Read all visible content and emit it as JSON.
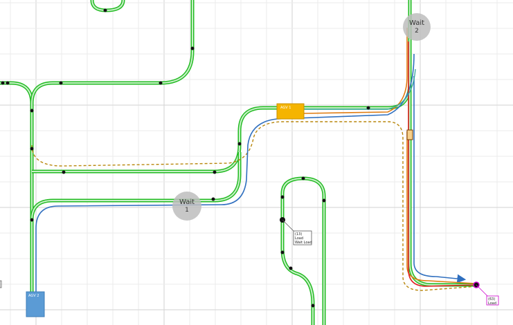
{
  "colors": {
    "background": "#ffffff",
    "grid_minor": "#ebebeb",
    "grid_major": "#d2d2d2",
    "track_outer": "#22bb22",
    "track_inner": "#c8f0c8",
    "route_blue": "#2f6fbf",
    "route_orange": "#e07b10",
    "route_dashed": "#b8860b",
    "route_red": "#e02020",
    "route_teal": "#3aa8a0",
    "node": "#111111",
    "agv1": "#f5b400",
    "agv2": "#5b9bd5",
    "wait_circle": "#bdbdbd",
    "highlight_node": "#cc00cc"
  },
  "wait_markers": [
    {
      "label": "Wait",
      "number": "1"
    },
    {
      "label": "Wait",
      "number": "2"
    }
  ],
  "agvs": [
    {
      "label": "AGV 1"
    },
    {
      "label": "AGV 2"
    }
  ],
  "station_labels": [
    {
      "lines": [
        "(13)",
        "Load",
        "Wait Load"
      ]
    },
    {
      "lines": [
        "(63)",
        "Load"
      ]
    }
  ]
}
